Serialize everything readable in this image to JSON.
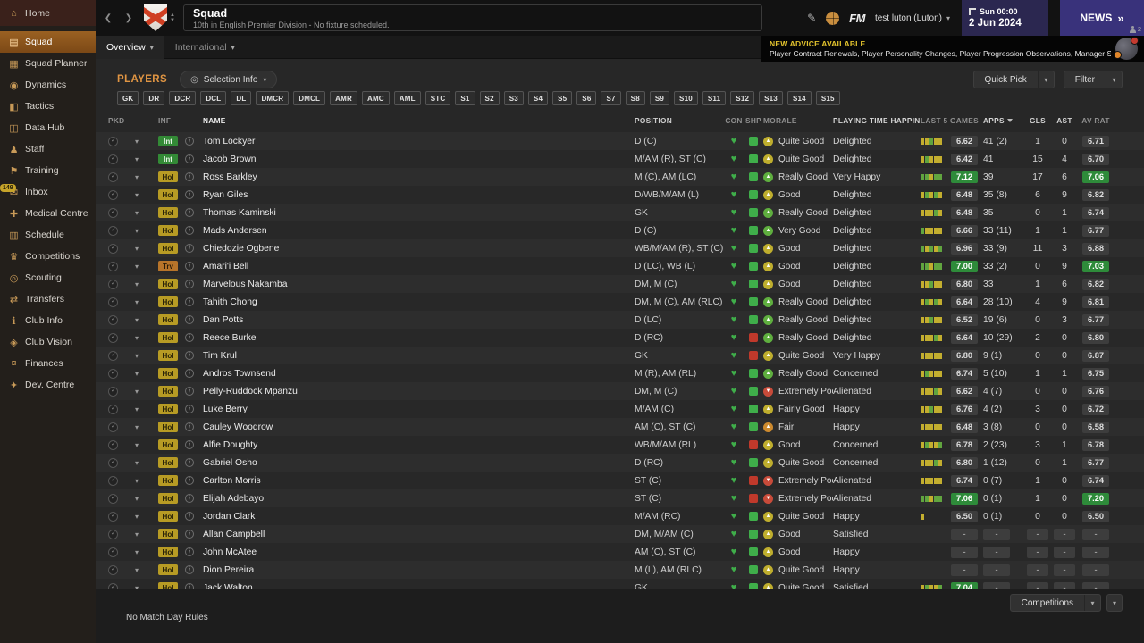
{
  "topbar": {
    "title": "Squad",
    "subtitle": "10th in English Premier Division - No fixture scheduled.",
    "fm_logo": "FM",
    "manager": "test luton (Luton)",
    "date_line1": "Sun 00:00",
    "date_line2": "2 Jun 2024",
    "news_label": "NEWS",
    "users_count": "2"
  },
  "sidebar": {
    "items": [
      {
        "label": "Home",
        "icon": "home-icon",
        "home": true
      },
      {
        "label": "Squad",
        "icon": "squad-icon",
        "active": true
      },
      {
        "label": "Squad Planner",
        "icon": "squad-planner-icon"
      },
      {
        "label": "Dynamics",
        "icon": "dynamics-icon"
      },
      {
        "label": "Tactics",
        "icon": "tactics-icon"
      },
      {
        "label": "Data Hub",
        "icon": "data-hub-icon"
      },
      {
        "label": "Staff",
        "icon": "staff-icon"
      },
      {
        "label": "Training",
        "icon": "training-icon"
      },
      {
        "label": "Inbox",
        "icon": "inbox-icon",
        "badge": "149"
      },
      {
        "label": "Medical Centre",
        "icon": "medical-centre-icon"
      },
      {
        "label": "Schedule",
        "icon": "schedule-icon"
      },
      {
        "label": "Competitions",
        "icon": "competitions-icon"
      },
      {
        "label": "Scouting",
        "icon": "scouting-icon"
      },
      {
        "label": "Transfers",
        "icon": "transfers-icon"
      },
      {
        "label": "Club Info",
        "icon": "club-info-icon"
      },
      {
        "label": "Club Vision",
        "icon": "club-vision-icon"
      },
      {
        "label": "Finances",
        "icon": "finances-icon"
      },
      {
        "label": "Dev. Centre",
        "icon": "dev-centre-icon"
      }
    ]
  },
  "tabs": {
    "overview": "Overview",
    "international": "International"
  },
  "advice": {
    "headline": "NEW ADVICE AVAILABLE",
    "body": "Player Contract Renewals, Player Personality Changes, Player Progression Observations, Manager Support"
  },
  "toolbar": {
    "players_label": "PLAYERS",
    "selection_info": "Selection Info",
    "quick_pick": "Quick Pick",
    "filter": "Filter"
  },
  "position_filters": [
    "GK",
    "DR",
    "DCR",
    "DCL",
    "DL",
    "DMCR",
    "DMCL",
    "AMR",
    "AMC",
    "AML",
    "STC",
    "S1",
    "S2",
    "S3",
    "S4",
    "S5",
    "S6",
    "S7",
    "S8",
    "S9",
    "S10",
    "S11",
    "S12",
    "S13",
    "S14",
    "S15"
  ],
  "colors": {
    "accent_orange": "#e09543",
    "condition_green": "#3fae4a",
    "sharpness_red": "#c0392b",
    "rating_highlight": "#2e8b3a",
    "morale": {
      "green": "#5faf3f",
      "yellow": "#bfae2e",
      "orange": "#cd8a2e",
      "red": "#c84b3a"
    },
    "form_bars": {
      "g": "#61a53f",
      "y": "#c3ae2f",
      "e": "#5a5a5a"
    }
  },
  "table": {
    "columns": [
      "PKD",
      "INF",
      "NAME",
      "POSITION",
      "CON",
      "SHP",
      "MORALE",
      "PLAYING TIME HAPPINESS",
      "LAST 5 GAMES",
      "APPS",
      "GLS",
      "AST",
      "AV RAT"
    ],
    "rows": [
      {
        "inf": "Int",
        "name": "Tom Lockyer",
        "pos": "D (C)",
        "con": "green",
        "shp": "green",
        "morale": "Quite Good",
        "morale_tone": "yellow",
        "happiness": "Delighted",
        "last5": [
          "y",
          "y",
          "g",
          "y",
          "y"
        ],
        "rating": "6.62",
        "rating_hl": false,
        "apps": "41 (2)",
        "gls": "1",
        "ast": "0",
        "avrat": "6.71",
        "avrat_hl": false
      },
      {
        "inf": "Int",
        "name": "Jacob Brown",
        "pos": "M/AM (R), ST (C)",
        "con": "green",
        "shp": "green",
        "morale": "Quite Good",
        "morale_tone": "yellow",
        "happiness": "Delighted",
        "last5": [
          "y",
          "g",
          "y",
          "y",
          "y"
        ],
        "rating": "6.42",
        "rating_hl": false,
        "apps": "41",
        "gls": "15",
        "ast": "4",
        "avrat": "6.70",
        "avrat_hl": false
      },
      {
        "inf": "Hol",
        "name": "Ross Barkley",
        "pos": "M (C), AM (LC)",
        "con": "green",
        "shp": "green",
        "morale": "Really Good",
        "morale_tone": "green",
        "happiness": "Very Happy",
        "last5": [
          "g",
          "g",
          "y",
          "g",
          "g"
        ],
        "rating": "7.12",
        "rating_hl": true,
        "apps": "39",
        "gls": "17",
        "ast": "6",
        "avrat": "7.06",
        "avrat_hl": true
      },
      {
        "inf": "Hol",
        "name": "Ryan Giles",
        "pos": "D/WB/M/AM (L)",
        "con": "green",
        "shp": "green",
        "morale": "Good",
        "morale_tone": "yellow",
        "happiness": "Delighted",
        "last5": [
          "y",
          "g",
          "y",
          "g",
          "y"
        ],
        "rating": "6.48",
        "rating_hl": false,
        "apps": "35 (8)",
        "gls": "6",
        "ast": "9",
        "avrat": "6.82",
        "avrat_hl": false
      },
      {
        "inf": "Hol",
        "name": "Thomas Kaminski",
        "pos": "GK",
        "con": "green",
        "shp": "green",
        "morale": "Really Good",
        "morale_tone": "green",
        "happiness": "Delighted",
        "last5": [
          "y",
          "y",
          "y",
          "g",
          "y"
        ],
        "rating": "6.48",
        "rating_hl": false,
        "apps": "35",
        "gls": "0",
        "ast": "1",
        "avrat": "6.74",
        "avrat_hl": false
      },
      {
        "inf": "Hol",
        "name": "Mads Andersen",
        "pos": "D (C)",
        "con": "green",
        "shp": "green",
        "morale": "Very Good",
        "morale_tone": "green",
        "happiness": "Delighted",
        "last5": [
          "g",
          "y",
          "y",
          "y",
          "y"
        ],
        "rating": "6.66",
        "rating_hl": false,
        "apps": "33 (11)",
        "gls": "1",
        "ast": "1",
        "avrat": "6.77",
        "avrat_hl": false
      },
      {
        "inf": "Hol",
        "name": "Chiedozie Ogbene",
        "pos": "WB/M/AM (R), ST (C)",
        "con": "green",
        "shp": "green",
        "morale": "Good",
        "morale_tone": "yellow",
        "happiness": "Delighted",
        "last5": [
          "g",
          "y",
          "g",
          "y",
          "g"
        ],
        "rating": "6.96",
        "rating_hl": false,
        "apps": "33 (9)",
        "gls": "11",
        "ast": "3",
        "avrat": "6.88",
        "avrat_hl": false
      },
      {
        "inf": "Trv",
        "name": "Amari'i Bell",
        "pos": "D (LC), WB (L)",
        "con": "green",
        "shp": "green",
        "morale": "Good",
        "morale_tone": "yellow",
        "happiness": "Delighted",
        "last5": [
          "g",
          "g",
          "y",
          "g",
          "g"
        ],
        "rating": "7.00",
        "rating_hl": true,
        "apps": "33 (2)",
        "gls": "0",
        "ast": "9",
        "avrat": "7.03",
        "avrat_hl": true
      },
      {
        "inf": "Hol",
        "name": "Marvelous Nakamba",
        "pos": "DM, M (C)",
        "con": "green",
        "shp": "green",
        "morale": "Good",
        "morale_tone": "yellow",
        "happiness": "Delighted",
        "last5": [
          "y",
          "y",
          "g",
          "y",
          "y"
        ],
        "rating": "6.80",
        "rating_hl": false,
        "apps": "33",
        "gls": "1",
        "ast": "6",
        "avrat": "6.82",
        "avrat_hl": false
      },
      {
        "inf": "Hol",
        "name": "Tahith Chong",
        "pos": "DM, M (C), AM (RLC)",
        "con": "green",
        "shp": "green",
        "morale": "Really Good",
        "morale_tone": "green",
        "happiness": "Delighted",
        "last5": [
          "y",
          "g",
          "y",
          "g",
          "y"
        ],
        "rating": "6.64",
        "rating_hl": false,
        "apps": "28 (10)",
        "gls": "4",
        "ast": "9",
        "avrat": "6.81",
        "avrat_hl": false
      },
      {
        "inf": "Hol",
        "name": "Dan Potts",
        "pos": "D (LC)",
        "con": "green",
        "shp": "green",
        "morale": "Really Good",
        "morale_tone": "green",
        "happiness": "Delighted",
        "last5": [
          "y",
          "y",
          "g",
          "y",
          "y"
        ],
        "rating": "6.52",
        "rating_hl": false,
        "apps": "19 (6)",
        "gls": "0",
        "ast": "3",
        "avrat": "6.77",
        "avrat_hl": false
      },
      {
        "inf": "Hol",
        "name": "Reece Burke",
        "pos": "D (RC)",
        "con": "green",
        "shp": "red",
        "morale": "Really Good",
        "morale_tone": "green",
        "happiness": "Delighted",
        "last5": [
          "y",
          "y",
          "y",
          "g",
          "y"
        ],
        "rating": "6.64",
        "rating_hl": false,
        "apps": "10 (29)",
        "gls": "2",
        "ast": "0",
        "avrat": "6.80",
        "avrat_hl": false
      },
      {
        "inf": "Hol",
        "name": "Tim Krul",
        "pos": "GK",
        "con": "green",
        "shp": "red",
        "morale": "Quite Good",
        "morale_tone": "yellow",
        "happiness": "Very Happy",
        "last5": [
          "y",
          "y",
          "y",
          "y",
          "y"
        ],
        "rating": "6.80",
        "rating_hl": false,
        "apps": "9 (1)",
        "gls": "0",
        "ast": "0",
        "avrat": "6.87",
        "avrat_hl": false
      },
      {
        "inf": "Hol",
        "name": "Andros Townsend",
        "pos": "M (R), AM (RL)",
        "con": "green",
        "shp": "green",
        "morale": "Really Good",
        "morale_tone": "green",
        "happiness": "Concerned",
        "last5": [
          "y",
          "g",
          "y",
          "y",
          "y"
        ],
        "rating": "6.74",
        "rating_hl": false,
        "apps": "5 (10)",
        "gls": "1",
        "ast": "1",
        "avrat": "6.75",
        "avrat_hl": false
      },
      {
        "inf": "Hol",
        "name": "Pelly-Ruddock Mpanzu",
        "pos": "DM, M (C)",
        "con": "green",
        "shp": "green",
        "morale": "Extremely Poor",
        "morale_tone": "red",
        "happiness": "Alienated",
        "last5": [
          "y",
          "y",
          "y",
          "g",
          "y"
        ],
        "rating": "6.62",
        "rating_hl": false,
        "apps": "4 (7)",
        "gls": "0",
        "ast": "0",
        "avrat": "6.76",
        "avrat_hl": false
      },
      {
        "inf": "Hol",
        "name": "Luke Berry",
        "pos": "M/AM (C)",
        "con": "green",
        "shp": "green",
        "morale": "Fairly Good",
        "morale_tone": "yellow",
        "happiness": "Happy",
        "last5": [
          "y",
          "y",
          "g",
          "y",
          "y"
        ],
        "rating": "6.76",
        "rating_hl": false,
        "apps": "4 (2)",
        "gls": "3",
        "ast": "0",
        "avrat": "6.72",
        "avrat_hl": false
      },
      {
        "inf": "Hol",
        "name": "Cauley Woodrow",
        "pos": "AM (C), ST (C)",
        "con": "green",
        "shp": "green",
        "morale": "Fair",
        "morale_tone": "orange",
        "happiness": "Happy",
        "last5": [
          "y",
          "y",
          "y",
          "y",
          "y"
        ],
        "rating": "6.48",
        "rating_hl": false,
        "apps": "3 (8)",
        "gls": "0",
        "ast": "0",
        "avrat": "6.58",
        "avrat_hl": false
      },
      {
        "inf": "Hol",
        "name": "Alfie Doughty",
        "pos": "WB/M/AM (RL)",
        "con": "green",
        "shp": "red",
        "morale": "Good",
        "morale_tone": "yellow",
        "happiness": "Concerned",
        "last5": [
          "y",
          "g",
          "y",
          "y",
          "g"
        ],
        "rating": "6.78",
        "rating_hl": false,
        "apps": "2 (23)",
        "gls": "3",
        "ast": "1",
        "avrat": "6.78",
        "avrat_hl": false
      },
      {
        "inf": "Hol",
        "name": "Gabriel Osho",
        "pos": "D (RC)",
        "con": "green",
        "shp": "green",
        "morale": "Quite Good",
        "morale_tone": "yellow",
        "happiness": "Concerned",
        "last5": [
          "y",
          "y",
          "y",
          "g",
          "y"
        ],
        "rating": "6.80",
        "rating_hl": false,
        "apps": "1 (12)",
        "gls": "0",
        "ast": "1",
        "avrat": "6.77",
        "avrat_hl": false
      },
      {
        "inf": "Hol",
        "name": "Carlton Morris",
        "pos": "ST (C)",
        "con": "green",
        "shp": "red",
        "morale": "Extremely Poor",
        "morale_tone": "red",
        "happiness": "Alienated",
        "last5": [
          "y",
          "y",
          "y",
          "y",
          "y"
        ],
        "rating": "6.74",
        "rating_hl": false,
        "apps": "0 (7)",
        "gls": "1",
        "ast": "0",
        "avrat": "6.74",
        "avrat_hl": false
      },
      {
        "inf": "Hol",
        "name": "Elijah Adebayo",
        "pos": "ST (C)",
        "con": "green",
        "shp": "red",
        "morale": "Extremely Poor",
        "morale_tone": "red",
        "happiness": "Alienated",
        "last5": [
          "g",
          "g",
          "y",
          "g",
          "g"
        ],
        "rating": "7.06",
        "rating_hl": true,
        "apps": "0 (1)",
        "gls": "1",
        "ast": "0",
        "avrat": "7.20",
        "avrat_hl": true
      },
      {
        "inf": "Hol",
        "name": "Jordan Clark",
        "pos": "M/AM (RC)",
        "con": "green",
        "shp": "green",
        "morale": "Quite Good",
        "morale_tone": "yellow",
        "happiness": "Happy",
        "last5": [
          "y"
        ],
        "rating": "6.50",
        "rating_hl": false,
        "apps": "0 (1)",
        "gls": "0",
        "ast": "0",
        "avrat": "6.50",
        "avrat_hl": false
      },
      {
        "inf": "Hol",
        "name": "Allan Campbell",
        "pos": "DM, M/AM (C)",
        "con": "green",
        "shp": "green",
        "morale": "Good",
        "morale_tone": "yellow",
        "happiness": "Satisfied",
        "last5": [],
        "rating": "-",
        "rating_hl": false,
        "apps": "-",
        "gls": "-",
        "ast": "-",
        "avrat": "-",
        "avrat_hl": false
      },
      {
        "inf": "Hol",
        "name": "John McAtee",
        "pos": "AM (C), ST (C)",
        "con": "green",
        "shp": "green",
        "morale": "Good",
        "morale_tone": "yellow",
        "happiness": "Happy",
        "last5": [],
        "rating": "-",
        "rating_hl": false,
        "apps": "-",
        "gls": "-",
        "ast": "-",
        "avrat": "-",
        "avrat_hl": false
      },
      {
        "inf": "Hol",
        "name": "Dion Pereira",
        "pos": "M (L), AM (RLC)",
        "con": "green",
        "shp": "green",
        "morale": "Quite Good",
        "morale_tone": "yellow",
        "happiness": "Happy",
        "last5": [],
        "rating": "-",
        "rating_hl": false,
        "apps": "-",
        "gls": "-",
        "ast": "-",
        "avrat": "-",
        "avrat_hl": false
      },
      {
        "inf": "Hol",
        "name": "Jack Walton",
        "pos": "GK",
        "con": "green",
        "shp": "green",
        "morale": "Quite Good",
        "morale_tone": "yellow",
        "happiness": "Satisfied",
        "last5": [
          "y",
          "g",
          "y",
          "y",
          "g"
        ],
        "rating": "7.04",
        "rating_hl": true,
        "apps": "-",
        "gls": "-",
        "ast": "-",
        "avrat": "-",
        "avrat_hl": false
      }
    ]
  },
  "footer": {
    "match_rules": "No Match Day Rules",
    "competitions": "Competitions"
  }
}
